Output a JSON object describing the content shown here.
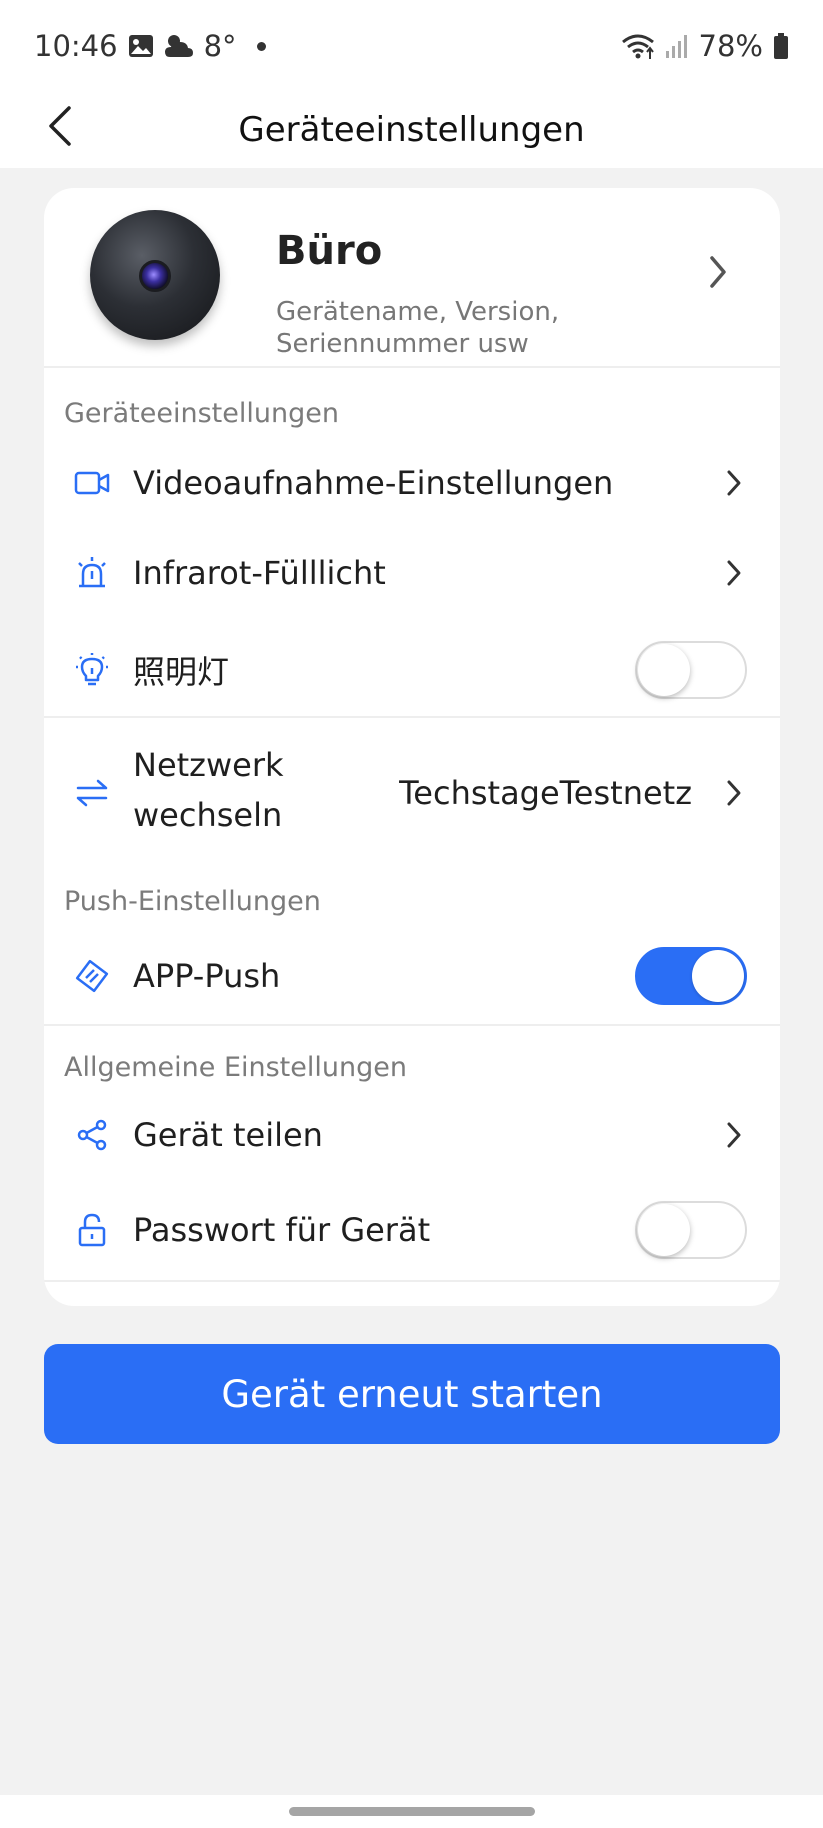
{
  "status_bar": {
    "time": "10:46",
    "temperature": "8°",
    "battery": "78%",
    "icons": [
      "gallery-icon",
      "weather-cloudy-icon",
      "wifi-icon",
      "signal-icon",
      "battery-icon"
    ]
  },
  "header": {
    "title": "Geräteeinstellungen",
    "back_icon": "chevron-left-icon"
  },
  "device": {
    "name": "Büro",
    "subtitle": "Gerätename, Version, Seriennummer usw"
  },
  "sections": {
    "device_settings": {
      "title": "Geräteeinstellungen",
      "video": "Videoaufnahme-Einstellungen",
      "infrared": "Infrarot-Fülllicht",
      "light": "照明灯",
      "light_on": false,
      "network_line1": "Netzwerk",
      "network_line2": "wechseln",
      "network_value": "TechstageTestnetz"
    },
    "push": {
      "title": "Push-Einstellungen",
      "app_push": "APP-Push",
      "app_push_on": true
    },
    "general": {
      "title": "Allgemeine Einstellungen",
      "share": "Gerät teilen",
      "password": "Passwort für Gerät",
      "password_on": false
    }
  },
  "restart_button": "Gerät erneut starten",
  "colors": {
    "accent": "#2a6ef5",
    "background": "#f2f2f2",
    "card": "#ffffff",
    "muted": "#7b7b7b"
  }
}
